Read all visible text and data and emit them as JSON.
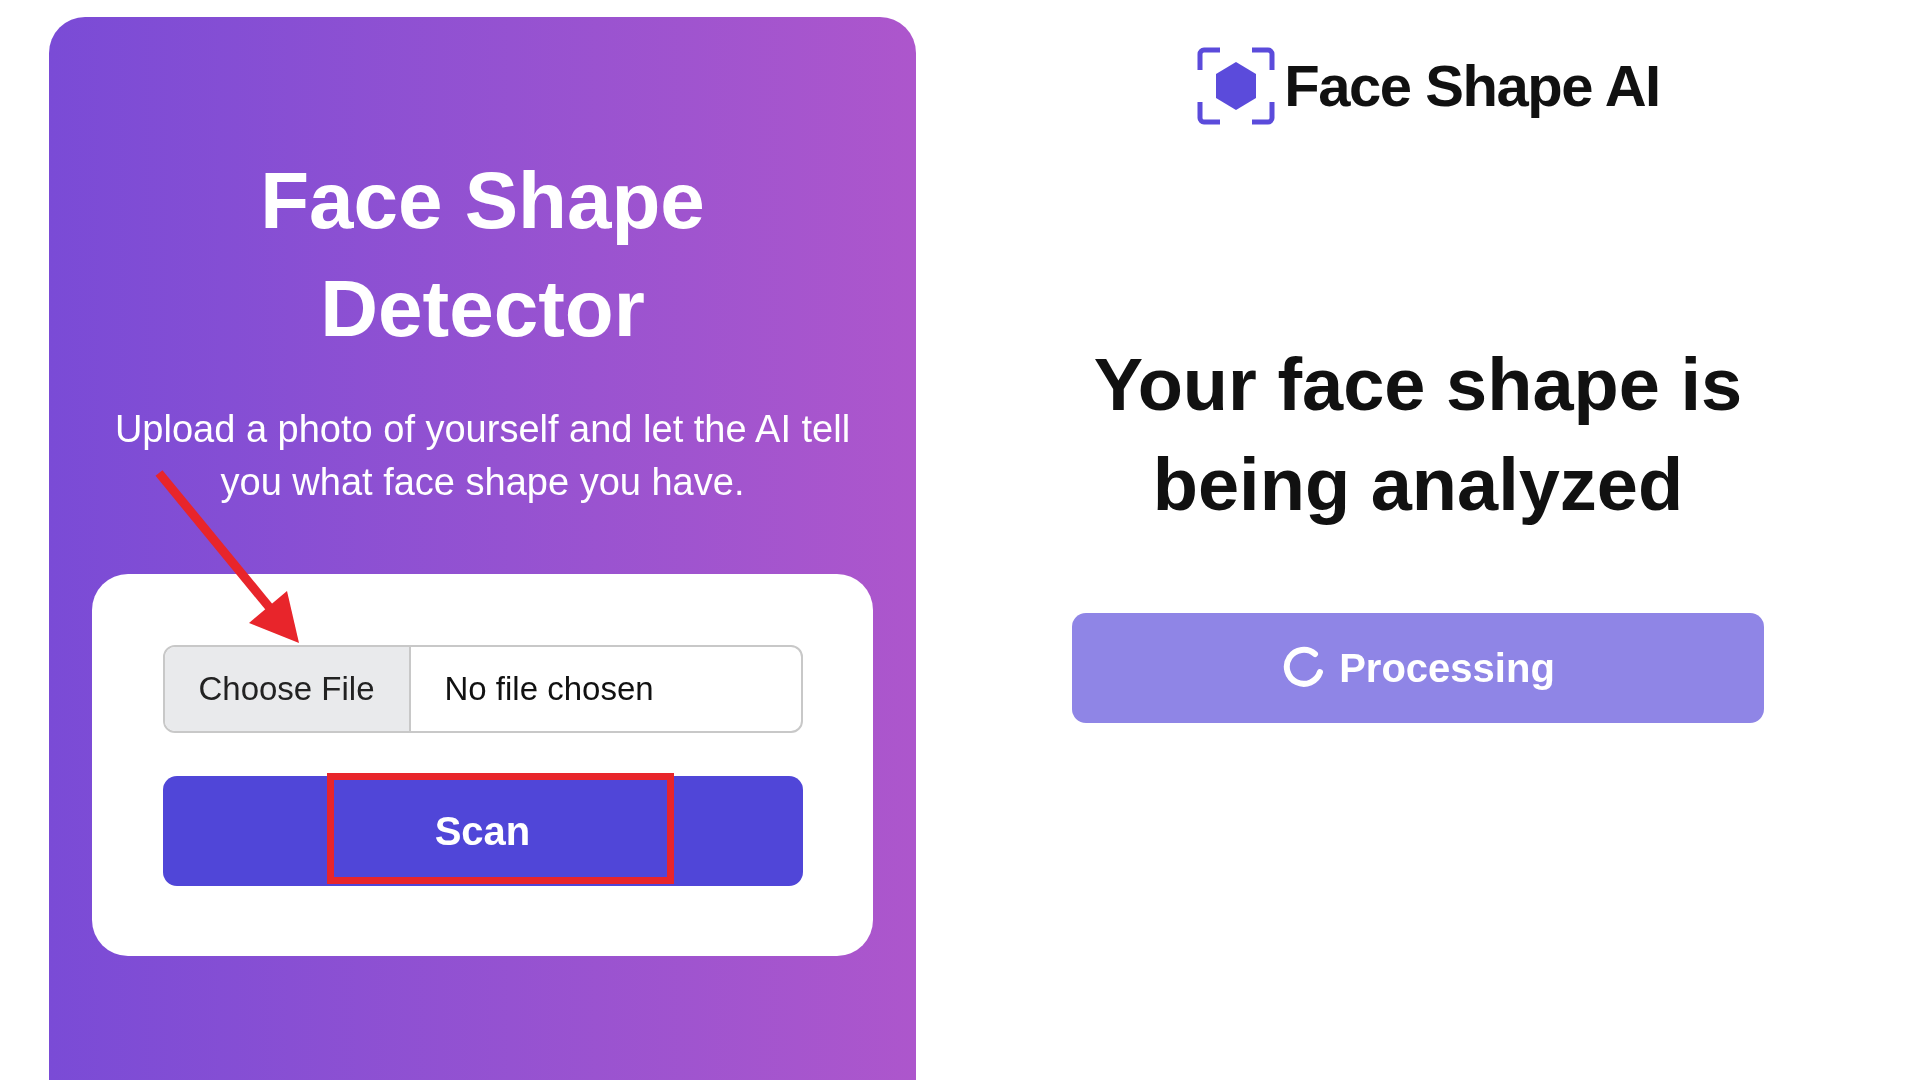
{
  "detector_card": {
    "title": "Face Shape Detector",
    "subtitle": "Upload a photo of yourself and let the AI tell you what face shape you have.",
    "file_input": {
      "button": "Choose File",
      "status": "No file chosen"
    },
    "scan_button": {
      "label": "Scan",
      "highlighted": true
    }
  },
  "result_panel": {
    "brand": "Face Shape AI",
    "heading": "Your face shape is being analyzed",
    "processing_button": {
      "label": "Processing",
      "disabled": true
    }
  }
}
